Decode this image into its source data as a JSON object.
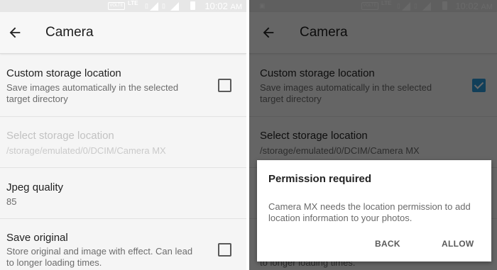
{
  "status_bar": {
    "time": "10:02",
    "ampm": "AM",
    "volte": "VOLTE",
    "lte": "LTE",
    "lte_sub": "4 G"
  },
  "app_bar": {
    "title": "Camera"
  },
  "prefs": {
    "custom_storage": {
      "title": "Custom storage location",
      "summary": "Save images automatically in the selected target directory"
    },
    "select_storage": {
      "title": "Select storage location",
      "summary": "/storage/emulated/0/DCIM/Camera MX"
    },
    "jpeg_quality": {
      "title": "Jpeg quality",
      "summary": "85"
    },
    "save_original": {
      "title": "Save original",
      "summary": "Store original and image with effect. Can lead to longer loading times."
    }
  },
  "left_state": {
    "custom_storage_checked": false,
    "save_original_checked": false
  },
  "right_state": {
    "custom_storage_checked": true
  },
  "dialog": {
    "title": "Permission required",
    "message": "Camera MX needs the location permission to add location information to your photos.",
    "back_label": "BACK",
    "allow_label": "ALLOW"
  },
  "colors": {
    "accent": "#2d9ad8",
    "scrim": "rgba(0,0,0,0.59)"
  }
}
